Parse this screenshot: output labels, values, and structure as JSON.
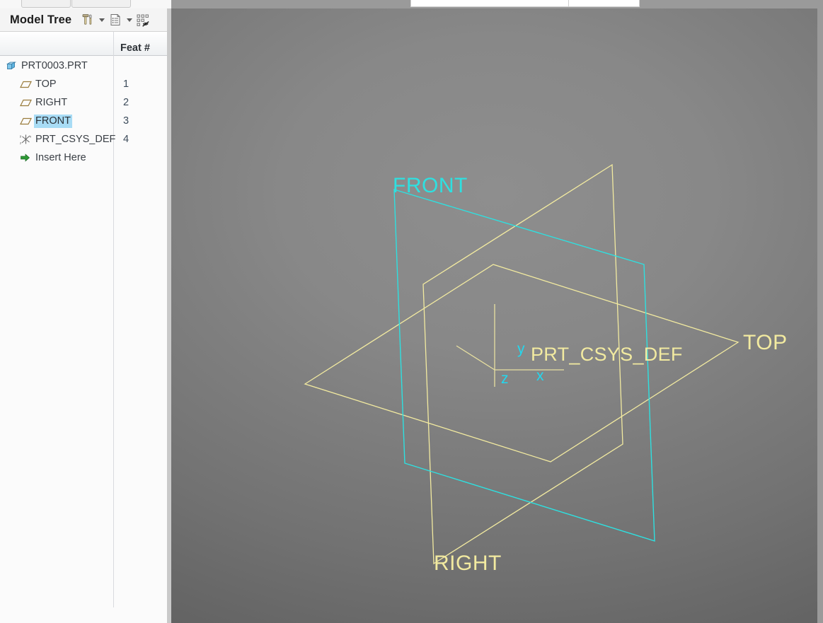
{
  "app": {
    "background_gradient_top": "#8e8e8e",
    "background_gradient_bottom": "#4f4f4f"
  },
  "model_tree": {
    "title": "Model Tree",
    "toolbar": [
      {
        "name": "settings-tools-icon",
        "label": "Settings",
        "has_caret": true
      },
      {
        "name": "display-list-icon",
        "label": "Display",
        "has_caret": true
      },
      {
        "name": "tree-filter-off-icon",
        "label": "Tree Filters",
        "has_caret": false
      }
    ],
    "columns": [
      {
        "key": "name",
        "label": ""
      },
      {
        "key": "feat",
        "label": "Feat #"
      }
    ],
    "rows": [
      {
        "label": "PRT0003.PRT",
        "feat": "",
        "icon": "part-icon",
        "indent": 0,
        "selected": false,
        "type": "part"
      },
      {
        "label": "TOP",
        "feat": "1",
        "icon": "datum-plane-icon",
        "indent": 1,
        "selected": false,
        "type": "plane"
      },
      {
        "label": "RIGHT",
        "feat": "2",
        "icon": "datum-plane-icon",
        "indent": 1,
        "selected": false,
        "type": "plane"
      },
      {
        "label": "FRONT",
        "feat": "3",
        "icon": "datum-plane-icon",
        "indent": 1,
        "selected": true,
        "type": "plane"
      },
      {
        "label": "PRT_CSYS_DEF",
        "feat": "4",
        "icon": "coordinate-system-icon",
        "indent": 1,
        "selected": false,
        "type": "csys"
      },
      {
        "label": "Insert Here",
        "feat": "",
        "icon": "insert-arrow-icon",
        "indent": 1,
        "selected": false,
        "type": "insert"
      }
    ],
    "colors": {
      "selection_highlight": "#a8dcf5",
      "label_text": "#3a3f45",
      "feat_text": "#3c4b5a",
      "plane_icon": "#9a7c3c",
      "part_icon": "#5aa8d8",
      "insert_arrow": "#2d9a35"
    }
  },
  "viewport": {
    "datum_planes": [
      {
        "name": "TOP",
        "label": "TOP",
        "color": "#f2eaa0",
        "selected": false
      },
      {
        "name": "RIGHT",
        "label": "RIGHT",
        "color": "#f2eaa0",
        "selected": false
      },
      {
        "name": "FRONT",
        "label": "FRONT",
        "color": "#2ee0e0",
        "selected": true
      }
    ],
    "coordinate_system": {
      "label": "PRT_CSYS_DEF",
      "label_color": "#f2eaa0",
      "axis_color": "#e8e0a0",
      "axis_label_color": "#22d8ef",
      "axes": [
        {
          "name": "x",
          "label": "x"
        },
        {
          "name": "y",
          "label": "y"
        },
        {
          "name": "z",
          "label": "z"
        }
      ]
    }
  }
}
